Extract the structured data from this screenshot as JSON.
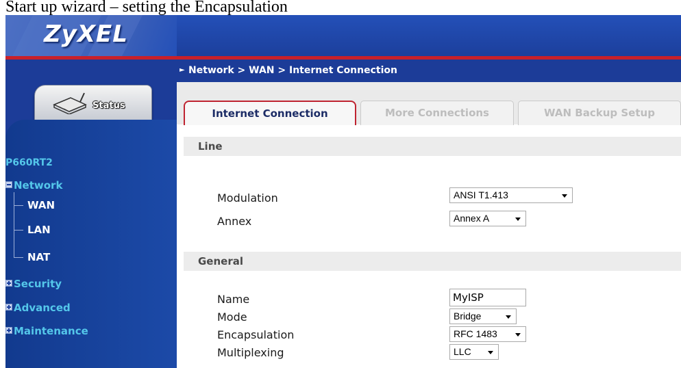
{
  "caption": "Start up wizard – setting the Encapsulation",
  "brand": {
    "logo": "ZyXEL",
    "accent": "#c8202a",
    "primary": "#1a3f9e"
  },
  "status_tab": {
    "label": "Status",
    "icon": "router-icon"
  },
  "nav": {
    "device": "P660RT2",
    "network": "Network",
    "network_children": [
      "WAN",
      "LAN",
      "NAT"
    ],
    "security": "Security",
    "advanced": "Advanced",
    "maintenance": "Maintenance"
  },
  "breadcrumb": "Network > WAN > Internet Connection",
  "tabs": [
    "Internet Connection",
    "More Connections",
    "WAN Backup Setup"
  ],
  "line_section": {
    "title": "Line",
    "modulation_label": "Modulation",
    "modulation_value": "ANSI T1.413",
    "annex_label": "Annex",
    "annex_value": "Annex A"
  },
  "general_section": {
    "title": "General",
    "name_label": "Name",
    "name_value": "MyISP",
    "mode_label": "Mode",
    "mode_value": "Bridge",
    "encapsulation_label": "Encapsulation",
    "encapsulation_value": "RFC 1483",
    "multiplexing_label": "Multiplexing",
    "multiplexing_value": "LLC"
  }
}
